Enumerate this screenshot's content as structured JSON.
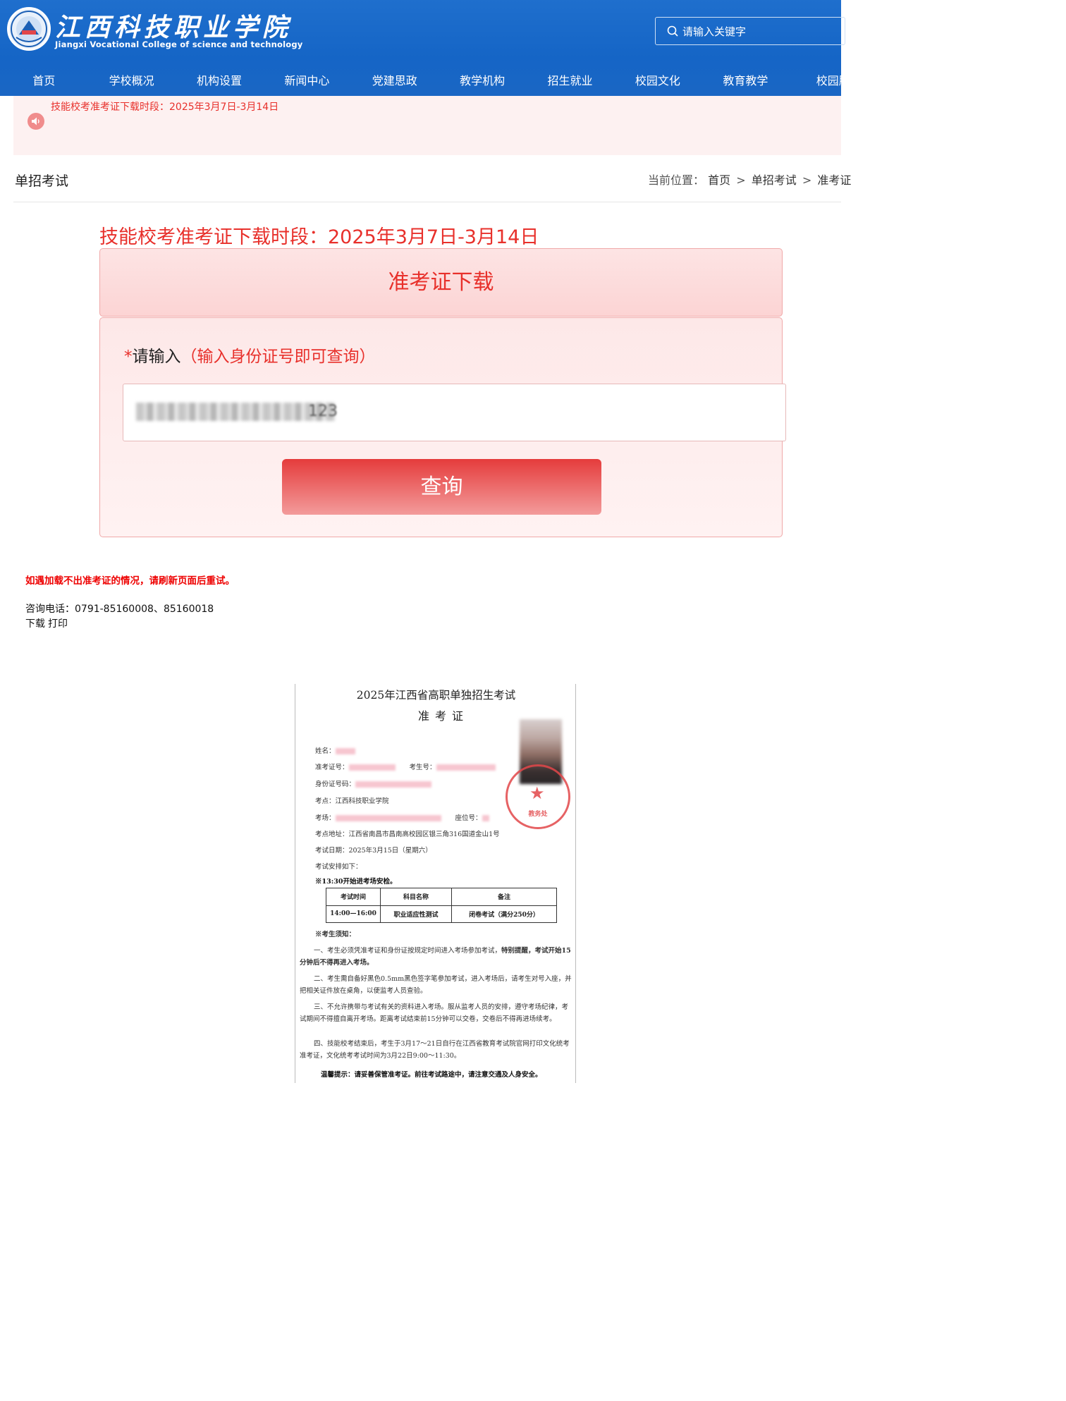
{
  "site": {
    "name_cn": "江西科技职业学院",
    "name_en": "Jiangxi Vocational College of science and technology"
  },
  "search": {
    "placeholder": "请输入关键字"
  },
  "nav": {
    "items": [
      {
        "label": "首页"
      },
      {
        "label": "学校概况"
      },
      {
        "label": "机构设置"
      },
      {
        "label": "新闻中心"
      },
      {
        "label": "党建思政"
      },
      {
        "label": "教学机构"
      },
      {
        "label": "招生就业"
      },
      {
        "label": "校园文化"
      },
      {
        "label": "教育教学"
      },
      {
        "label": "校园服"
      }
    ]
  },
  "notice": {
    "text": "技能校考准考证下载时段：2025年3月7日-3月14日"
  },
  "page": {
    "title": "单招考试",
    "breadcrumb_prefix": "当前位置：",
    "breadcrumb": [
      "首页",
      "单招考试",
      "准考证"
    ],
    "breadcrumb_sep": ">"
  },
  "main": {
    "headline": "技能校考准考证下载时段：2025年3月7日-3月14日",
    "card_title": "准考证下载",
    "input_star": "*",
    "input_label": "请输入",
    "input_hint": "（输入身份证号即可查询）",
    "id_suffix": "123",
    "query_button": "查询"
  },
  "notes": {
    "warning": "如遇加载不出准考证的情况，请刷新页面后重试。",
    "phone": "咨询电话：0791-85160008、85160018",
    "download": "下载",
    "print": "打印"
  },
  "ticket": {
    "title": "2025年江西省高职单独招生考试",
    "subtitle": "准考证",
    "name_label": "姓名：",
    "admission_no_label": "准考证号：",
    "student_no_label": "考生号：",
    "id_label": "身份证号码：",
    "site_label": "考点：",
    "site_value": "江西科技职业学院",
    "room_label": "考场：",
    "seat_label": "座位号：",
    "address": "考点地址：江西省南昌市昌南高校园区银三角316国道金山1号",
    "date": "考试日期：2025年3月15日（星期六）",
    "arrangement": "考试安排如下：",
    "entry_time": "※13:30开始进考场安检。",
    "table_headers": [
      "考试时间",
      "科目名称",
      "备注"
    ],
    "table_row": [
      "14:00—16:00",
      "职业适应性测试",
      "闭卷考试（满分250分）"
    ],
    "notice_head": "※考生须知：",
    "rule1_a": "一、考生必须凭准考证和身份证按规定时间进入考场参加考试，",
    "rule1_b": "特别提醒，考试开始15分钟后不得再进入考场。",
    "rule2": "二、考生需自备好黑色0.5mm黑色签字笔参加考试，进入考场后，请考生对号入座，并把相关证件放在桌角，以便监考人员查验。",
    "rule3": "三、不允许携带与考试有关的资料进入考场。服从监考人员的安排，遵守考场纪律，考试期间不得擅自离开考场。距离考试结束前15分钟可以交卷，交卷后不得再进场续考。",
    "rule4": "四、技能校考结束后，考生于3月17～21日自行在江西省教育考试院官网打印文化统考准考证，文化统考考试时间为3月22日9:00～11:30。",
    "reminder": "温馨提示：请妥善保管准考证。前往考试路途中，请注意交通及人身安全。",
    "stamp_text": "教务处"
  },
  "colors": {
    "header_blue": "#1565c6",
    "accent_red": "#e8302b",
    "card_pink": "#fde4e4",
    "stamp_red": "#e2474a"
  }
}
